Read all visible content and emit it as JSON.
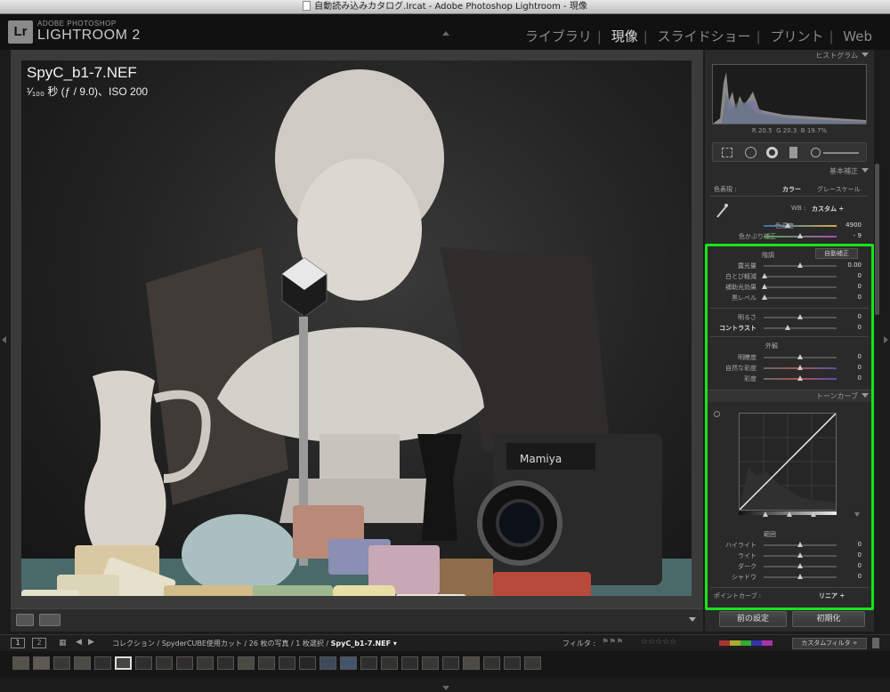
{
  "window": {
    "title": "自動読み込みカタログ.lrcat - Adobe Photoshop Lightroom - 現像"
  },
  "app": {
    "brand_small": "ADOBE PHOTOSHOP",
    "brand_main": "LIGHTROOM 2",
    "logo": "Lr"
  },
  "modules": [
    {
      "label": "ライブラリ",
      "active": false
    },
    {
      "label": "現像",
      "active": true
    },
    {
      "label": "スライドショー",
      "active": false
    },
    {
      "label": "プリント",
      "active": false
    },
    {
      "label": "Web",
      "active": false
    }
  ],
  "photo": {
    "filename": "SpyC_b1-7.NEF",
    "exposure_info": "¹⁄₁₀₀ 秒 (ƒ / 9.0)、ISO 200"
  },
  "histogram": {
    "title": "ヒストグラム",
    "r_label": "R",
    "r": "20.5",
    "g_label": "G",
    "g": "20.3",
    "b_label": "B",
    "b": "19.7",
    "pct": "%"
  },
  "basic": {
    "title": "基本補正",
    "treatment_label": "色表現 :",
    "treatment_color": "カラー",
    "treatment_gray": "グレースケール",
    "wb_label": "WB :",
    "wb_value": "カスタム ÷",
    "temp_label": "色温度",
    "temp_value": "4900",
    "tint_label": "色かぶり補正",
    "tint_value": "- 9",
    "tone_label": "階調",
    "auto_tone": "自動補正",
    "exposure_label": "露光量",
    "exposure_value": "0.00",
    "recovery_label": "白とび軽減",
    "recovery_value": "0",
    "fill_label": "補助光効果",
    "fill_value": "0",
    "blacks_label": "黒レベル",
    "blacks_value": "0",
    "brightness_label": "明るさ",
    "brightness_value": "0",
    "contrast_label": "コントラスト",
    "contrast_value": "0",
    "presence_label": "外観",
    "clarity_label": "明瞭度",
    "clarity_value": "0",
    "vibrance_label": "自然な彩度",
    "vibrance_value": "0",
    "saturation_label": "彩度",
    "saturation_value": "0"
  },
  "tone_curve": {
    "title": "トーンカーブ",
    "region_label": "範囲",
    "highlights_label": "ハイライト",
    "highlights_value": "0",
    "lights_label": "ライト",
    "lights_value": "0",
    "darks_label": "ダーク",
    "darks_value": "0",
    "shadows_label": "シャドウ",
    "shadows_value": "0",
    "point_curve_label": "ポイントカーブ :",
    "point_curve_value": "リニア ÷"
  },
  "buttons": {
    "previous": "前の設定",
    "reset": "初期化"
  },
  "filmstrip": {
    "page1": "1",
    "page2": "2",
    "path_prefix": "コレクション / SpyderCUBE使用カット / 26 枚の写真 / 1 枚選択 / ",
    "path_file": "SpyC_b1-7.NEF ▾",
    "filter_label": "フィルタ :",
    "custom_filter": "カスタムフィルタ ÷"
  },
  "colors": {
    "highlight": "#16e51b",
    "panel_bg": "#2a2a2a"
  }
}
